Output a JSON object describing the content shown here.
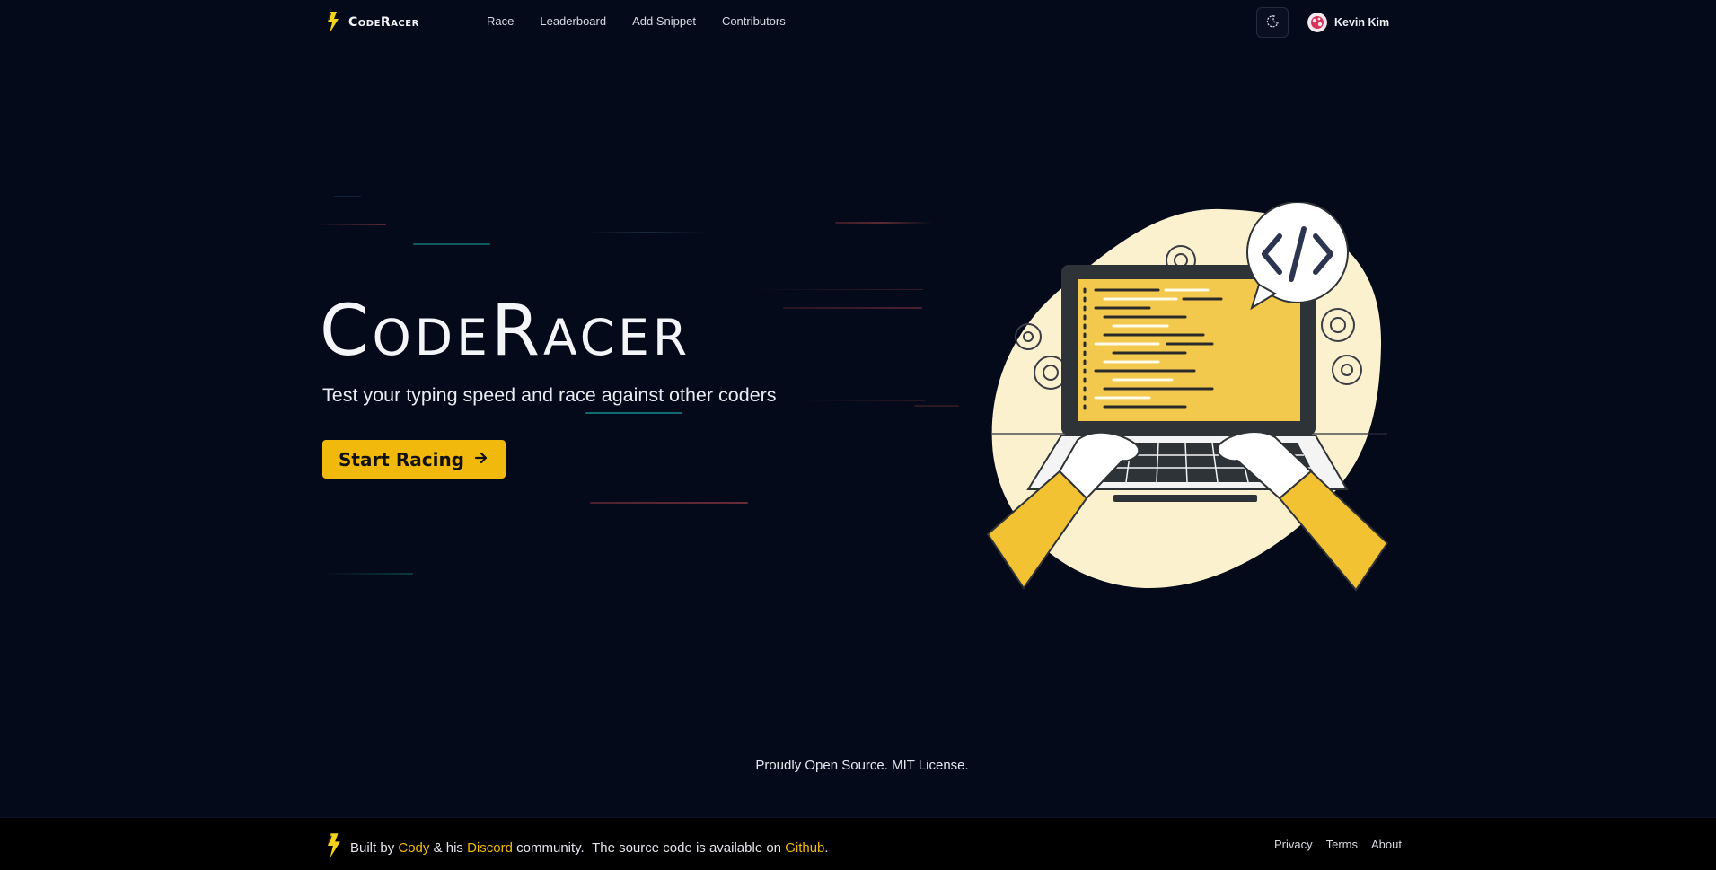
{
  "nav": {
    "brand": "CodeRacer",
    "links": [
      "Race",
      "Leaderboard",
      "Add Snippet",
      "Contributors"
    ],
    "user_name": "Kevin Kim"
  },
  "hero": {
    "title": "CodeRacer",
    "subtitle": "Test your typing speed and race against other coders",
    "cta_label": "Start Racing"
  },
  "license_text": "Proudly Open Source. MIT License.",
  "footer": {
    "built_by": "Built by",
    "author": "Cody",
    "amp_his": "& his",
    "discord": "Discord",
    "community": "community.",
    "source_text": "The source code is available on",
    "github": "Github",
    "period": ".",
    "links": [
      "Privacy",
      "Terms",
      "About"
    ]
  },
  "colors": {
    "background": "#050a1a",
    "accent": "#f0b90b",
    "footer_bg": "#000000"
  }
}
